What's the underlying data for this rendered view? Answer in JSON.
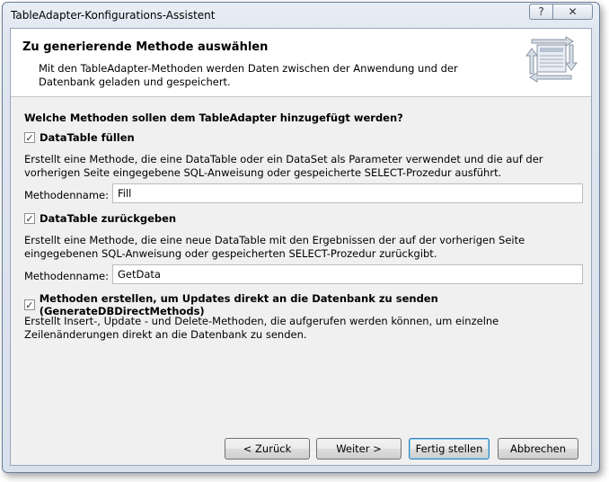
{
  "window": {
    "title": "TableAdapter-Konfigurations-Assistent",
    "help_glyph": "?",
    "close_glyph": "✕"
  },
  "header": {
    "title": "Zu generierende Methode auswählen",
    "subtitle": "Mit den TableAdapter-Methoden werden Daten zwischen der Anwendung und der Datenbank geladen und gespeichert.",
    "icon": "wizard-table-icon"
  },
  "question": "Welche Methoden sollen dem TableAdapter hinzugefügt werden?",
  "options": [
    {
      "label": "DataTable füllen",
      "checked": true,
      "description": "Erstellt eine Methode, die eine DataTable oder ein DataSet als Parameter verwendet und die auf der vorherigen Seite eingegebene SQL-Anweisung oder gespeicherte SELECT-Prozedur ausführt.",
      "field_label": "Methodenname:",
      "field_value": "Fill"
    },
    {
      "label": "DataTable zurückgeben",
      "checked": true,
      "description": "Erstellt eine Methode, die eine neue DataTable mit den Ergebnissen der auf der vorherigen Seite eingegebenen SQL-Anweisung oder gespeicherten SELECT-Prozedur zurückgibt.",
      "field_label": "Methodenname:",
      "field_value": "GetData"
    },
    {
      "label": "Methoden erstellen, um Updates direkt an die Datenbank zu senden (GenerateDBDirectMethods)",
      "checked": true,
      "description": "Erstellt Insert-, Update - und Delete-Methoden, die aufgerufen werden können, um einzelne Zeilenänderungen direkt an die Datenbank zu senden."
    }
  ],
  "check_glyph": "✓",
  "buttons": {
    "back": "< Zurück",
    "next": "Weiter >",
    "finish": "Fertig stellen",
    "cancel": "Abbrechen"
  }
}
